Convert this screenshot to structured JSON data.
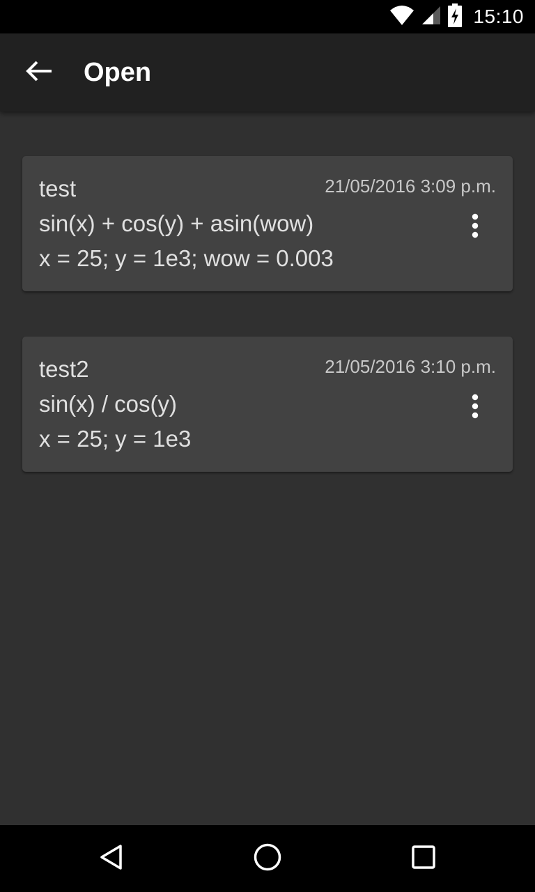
{
  "status_bar": {
    "time": "15:10",
    "icons": [
      "wifi-icon",
      "signal-icon",
      "battery-charging-icon"
    ]
  },
  "app_bar": {
    "back_icon": "arrow-back-icon",
    "title": "Open"
  },
  "files": [
    {
      "name": "test",
      "date": "21/05/2016 3:09 p.m.",
      "expression": "sin(x) + cos(y) + asin(wow)",
      "variables": "x = 25; y = 1e3; wow = 0.003"
    },
    {
      "name": "test2",
      "date": "21/05/2016 3:10 p.m.",
      "expression": "sin(x) / cos(y)",
      "variables": "x = 25; y = 1e3"
    }
  ],
  "nav_bar": {
    "icons": [
      "back-triangle-icon",
      "home-circle-icon",
      "recents-square-icon"
    ]
  },
  "colors": {
    "background": "#303030",
    "app_bar": "#212121",
    "card": "#424242",
    "text": "#e0e0e0",
    "bars": "#000000"
  }
}
